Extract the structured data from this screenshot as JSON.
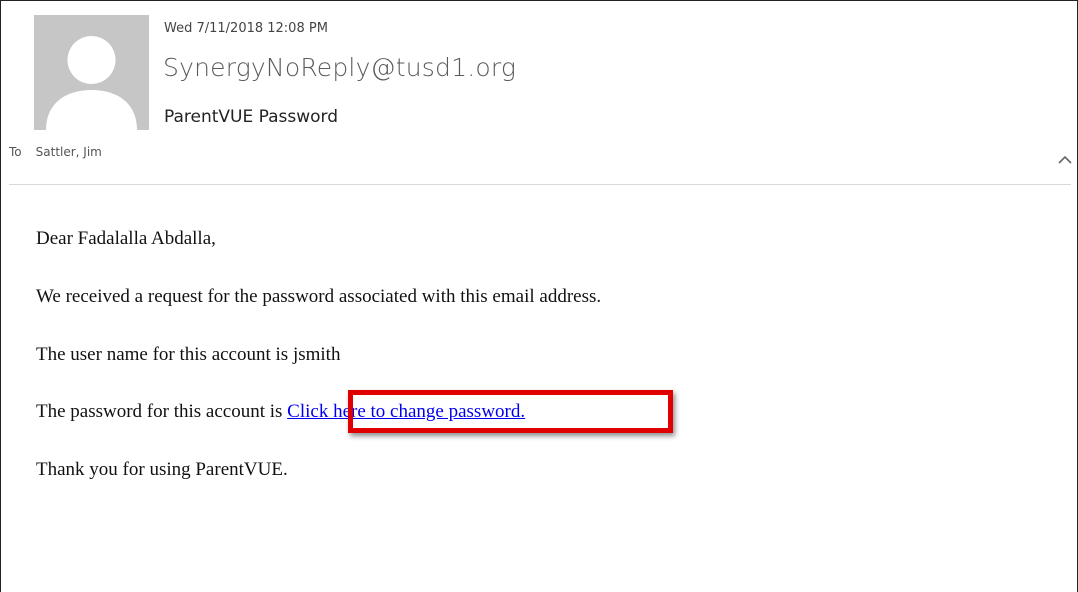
{
  "header": {
    "date": "Wed 7/11/2018 12:08 PM",
    "sender": "SynergyNoReply@tusd1.org",
    "subject": "ParentVUE Password",
    "to_label": "To",
    "recipient": "Sattler, Jim"
  },
  "icons": {
    "avatar": "person-silhouette-icon",
    "collapse": "chevron-up-icon"
  },
  "body": {
    "greeting": "Dear Fadalalla Abdalla,",
    "line1": "We received a request for the password associated with this email address.",
    "line2": "The user name for this account is jsmith",
    "line3_prefix": "The password for this account is ",
    "line3_link": "Click here to change password.",
    "line4": "Thank you for using ParentVUE."
  },
  "colors": {
    "highlight": "#e00000",
    "link": "#0000ee",
    "avatar_bg": "#c6c6c6"
  }
}
